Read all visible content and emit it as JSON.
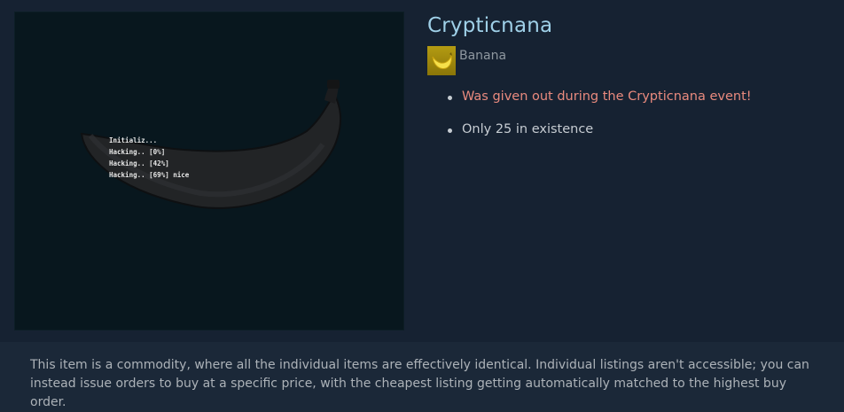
{
  "item": {
    "name": "Crypticnana",
    "game": "Banana",
    "descriptions": [
      {
        "text": "Was given out during the Crypticnana event!",
        "color": "#e98a7e"
      },
      {
        "text": "Only 25 in existence",
        "color": "#c6ccd2"
      }
    ],
    "image_text_lines": [
      "Initializ...",
      "Hacking.. [0%]",
      "Hacking.. [42%]",
      "Hacking.. [69%] nice"
    ]
  },
  "commodity_note": "This item is a commodity, where all the individual items are effectively identical. Individual listings aren't accessible; you can instead issue orders to buy at a specific price, with the cheapest listing getting automatically matched to the highest buy order.",
  "colors": {
    "background": "#1b2838",
    "title": "#9fd0e8",
    "special_description": "#e98a7e",
    "description": "#c6ccd2"
  },
  "icons": {
    "game_icon": "banana-icon"
  }
}
